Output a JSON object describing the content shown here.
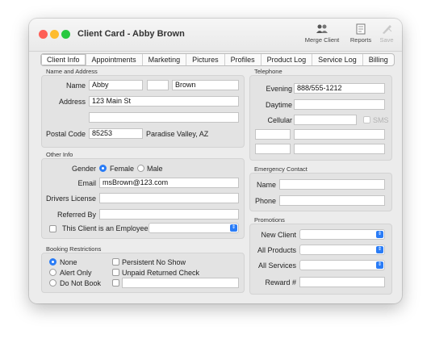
{
  "window": {
    "title": "Client Card - Abby Brown",
    "toolbar": [
      {
        "label": "Merge Client",
        "icon": "merge-client-icon"
      },
      {
        "label": "Reports",
        "icon": "reports-icon"
      },
      {
        "label": "Save",
        "icon": "save-icon"
      }
    ]
  },
  "tabs": [
    "Client Info",
    "Appointments",
    "Marketing",
    "Pictures",
    "Profiles",
    "Product Log",
    "Service Log",
    "Billing"
  ],
  "name_address": {
    "section": "Name and Address",
    "name_label": "Name",
    "first_name": "Abby",
    "middle_name": "",
    "last_name": "Brown",
    "address_label": "Address",
    "address1": "123 Main St",
    "address2": "",
    "postal_label": "Postal Code",
    "postal_code": "85253",
    "city_state": "Paradise Valley, AZ"
  },
  "telephone": {
    "section": "Telephone",
    "evening_label": "Evening",
    "evening": "888/555-1212",
    "daytime_label": "Daytime",
    "daytime": "",
    "cellular_label": "Cellular",
    "cellular": "",
    "sms_label": "SMS"
  },
  "other_info": {
    "section": "Other Info",
    "gender_label": "Gender",
    "gender_options": [
      "Female",
      "Male"
    ],
    "gender_selected": "Female",
    "email_label": "Email",
    "email": "msBrown@123.com",
    "license_label": "Drivers License",
    "license": "",
    "referred_label": "Referred By",
    "referred": "",
    "employee_label": "This Client is an Employee"
  },
  "emergency": {
    "section": "Emergency Contact",
    "name_label": "Name",
    "name": "",
    "phone_label": "Phone",
    "phone": ""
  },
  "booking": {
    "section": "Booking Restrictions",
    "options": [
      "None",
      "Alert Only",
      "Do Not Book"
    ],
    "selected": "None",
    "checks": [
      "Persistent No Show",
      "Unpaid Returned Check"
    ]
  },
  "promotions": {
    "section": "Promotions",
    "new_client_label": "New Client",
    "all_products_label": "All Products",
    "all_services_label": "All Services",
    "reward_label": "Reward #",
    "reward": ""
  },
  "colors": {
    "accent": "#2a7cf6",
    "close": "#fe5f57",
    "minimize": "#febc2e",
    "zoom": "#28c840"
  }
}
